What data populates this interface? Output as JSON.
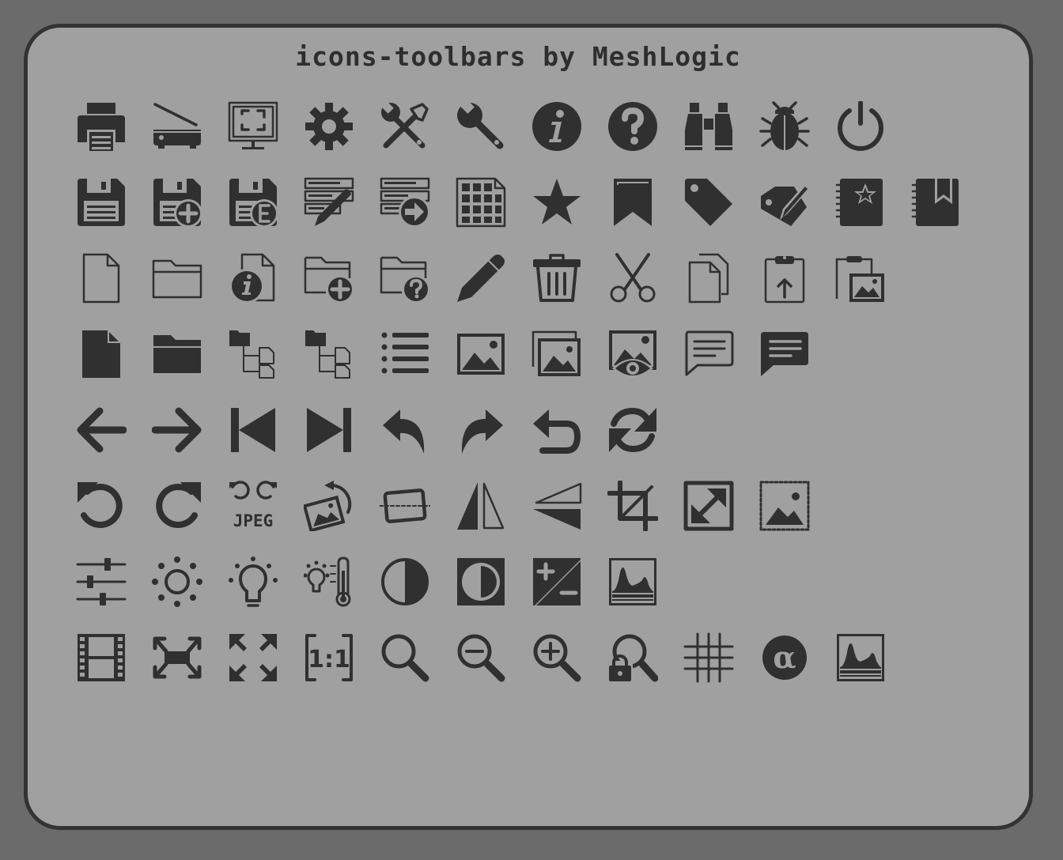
{
  "title": "icons-toolbars by MeshLogic",
  "labels": {
    "jpeg": "JPEG",
    "one_to_one": "1:1",
    "alpha": "α"
  },
  "colors": {
    "page_background": "#6b6b6b",
    "panel_background": "#a0a0a0",
    "panel_border": "#333333",
    "icon": "#303030"
  },
  "rows": [
    [
      "printer-icon",
      "scanner-icon",
      "fullscreen-monitor-icon",
      "gear-icon",
      "tools-icon",
      "wrench-icon",
      "info-icon",
      "help-icon",
      "binoculars-icon",
      "bug-icon",
      "power-icon"
    ],
    [
      "save-icon",
      "save-new-icon",
      "save-export-icon",
      "form-edit-icon",
      "form-submit-icon",
      "table-icon",
      "star-icon",
      "bookmark-icon",
      "tag-icon",
      "tag-edit-icon",
      "notebook-star-icon",
      "notebook-bookmark-icon"
    ],
    [
      "new-file-icon",
      "open-folder-icon",
      "file-info-icon",
      "new-folder-icon",
      "folder-help-icon",
      "pencil-icon",
      "trash-icon",
      "scissors-icon",
      "copy-icon",
      "paste-icon",
      "paste-image-icon"
    ],
    [
      "file-filled-icon",
      "folder-filled-icon",
      "folder-tree-icon",
      "folder-tree-alt-icon",
      "list-icon",
      "image-icon",
      "images-icon",
      "image-preview-icon",
      "comment-icon",
      "comment-filled-icon"
    ],
    [
      "arrow-left-icon",
      "arrow-right-icon",
      "skip-first-icon",
      "skip-last-icon",
      "undo-icon",
      "redo-icon",
      "return-icon",
      "refresh-icon"
    ],
    [
      "rotate-left-icon",
      "rotate-right-icon",
      "jpeg-rotate-icon",
      "image-rotate-icon",
      "straighten-icon",
      "flip-horizontal-icon",
      "flip-vertical-icon",
      "crop-icon",
      "resize-icon",
      "image-select-icon"
    ],
    [
      "sliders-icon",
      "brightness-icon",
      "bulb-icon",
      "temperature-icon",
      "contrast-icon",
      "contrast-box-icon",
      "exposure-icon",
      "histogram-icon"
    ],
    [
      "film-icon",
      "fit-horizontal-icon",
      "fit-all-icon",
      "actual-size-icon",
      "zoom-icon",
      "zoom-out-icon",
      "zoom-in-icon",
      "zoom-lock-icon",
      "grid-icon",
      "alpha-icon",
      "histogram-alt-icon"
    ]
  ]
}
